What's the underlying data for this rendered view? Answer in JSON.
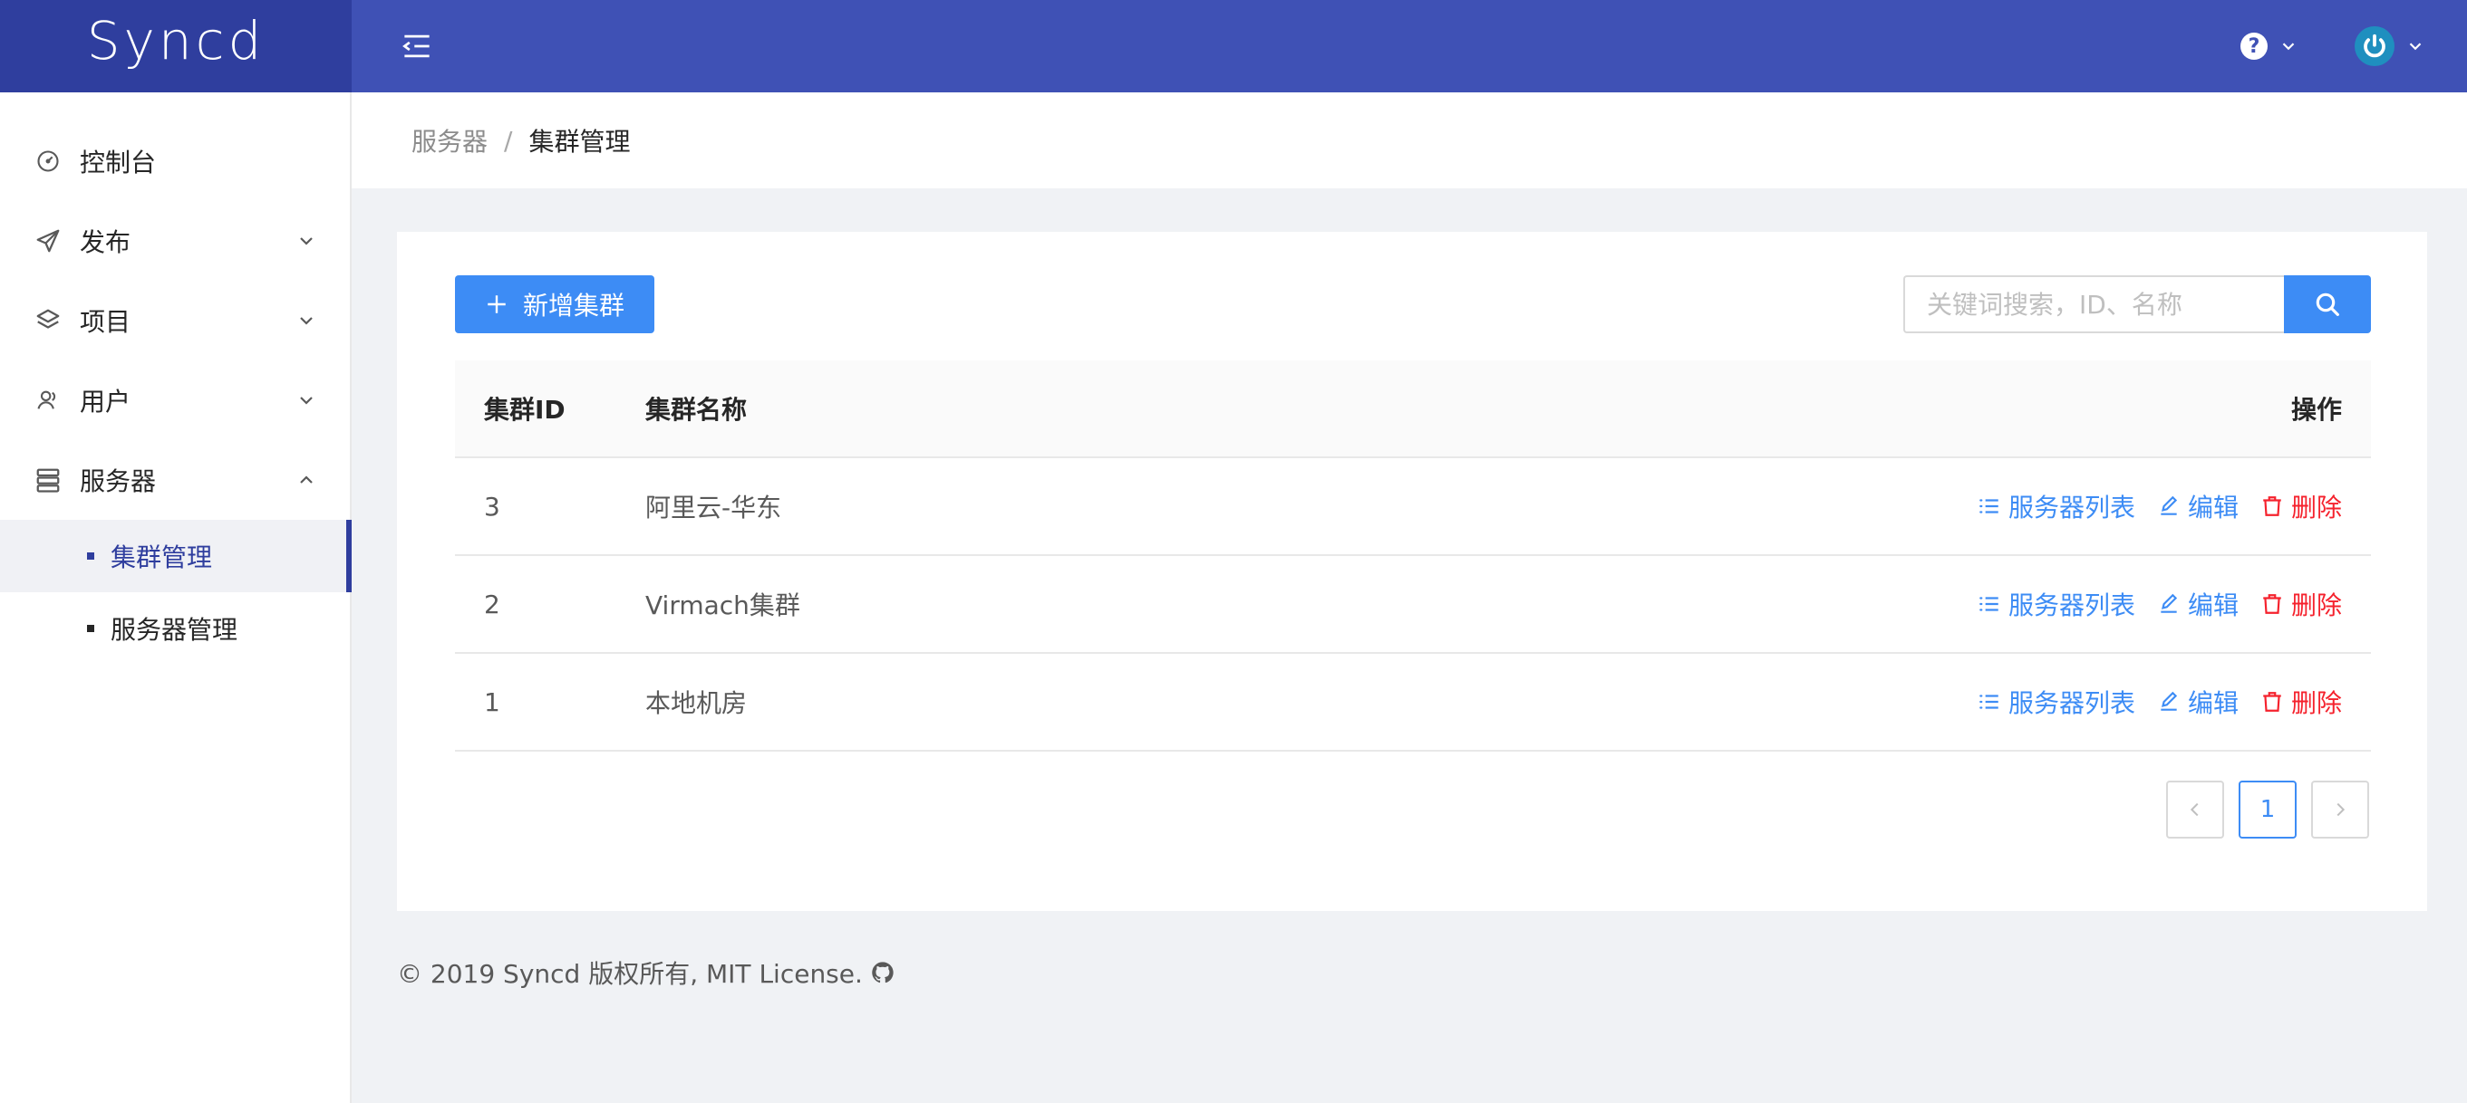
{
  "app": {
    "logo": "Syncd"
  },
  "sidebar": {
    "items": [
      {
        "label": "控制台",
        "icon": "dashboard-icon",
        "has_arrow": false
      },
      {
        "label": "发布",
        "icon": "send-icon",
        "has_arrow": true,
        "expanded": false
      },
      {
        "label": "项目",
        "icon": "layers-icon",
        "has_arrow": true,
        "expanded": false
      },
      {
        "label": "用户",
        "icon": "user-icon",
        "has_arrow": true,
        "expanded": false
      },
      {
        "label": "服务器",
        "icon": "server-icon",
        "has_arrow": true,
        "expanded": true
      }
    ],
    "subitems": [
      {
        "label": "集群管理",
        "active": true
      },
      {
        "label": "服务器管理",
        "active": false
      }
    ]
  },
  "header": {
    "help_icon": "?"
  },
  "breadcrumb": {
    "items": [
      "服务器",
      "集群管理"
    ],
    "separator": "/"
  },
  "toolbar": {
    "add_label": "新增集群",
    "search_placeholder": "关键词搜索，ID、名称"
  },
  "table": {
    "columns": [
      "集群ID",
      "集群名称",
      "操作"
    ],
    "rows": [
      {
        "id": "3",
        "name": "阿里云-华东"
      },
      {
        "id": "2",
        "name": "Virmach集群"
      },
      {
        "id": "1",
        "name": "本地机房"
      }
    ],
    "actions": {
      "list": "服务器列表",
      "edit": "编辑",
      "delete": "删除"
    }
  },
  "pagination": {
    "current": "1"
  },
  "footer": {
    "text": "© 2019 Syncd 版权所有, MIT License."
  },
  "colors": {
    "primary": "#3d8cf5",
    "header": "#3f51b5",
    "logo_bg": "#2f3e9e",
    "danger": "#f5222d"
  }
}
